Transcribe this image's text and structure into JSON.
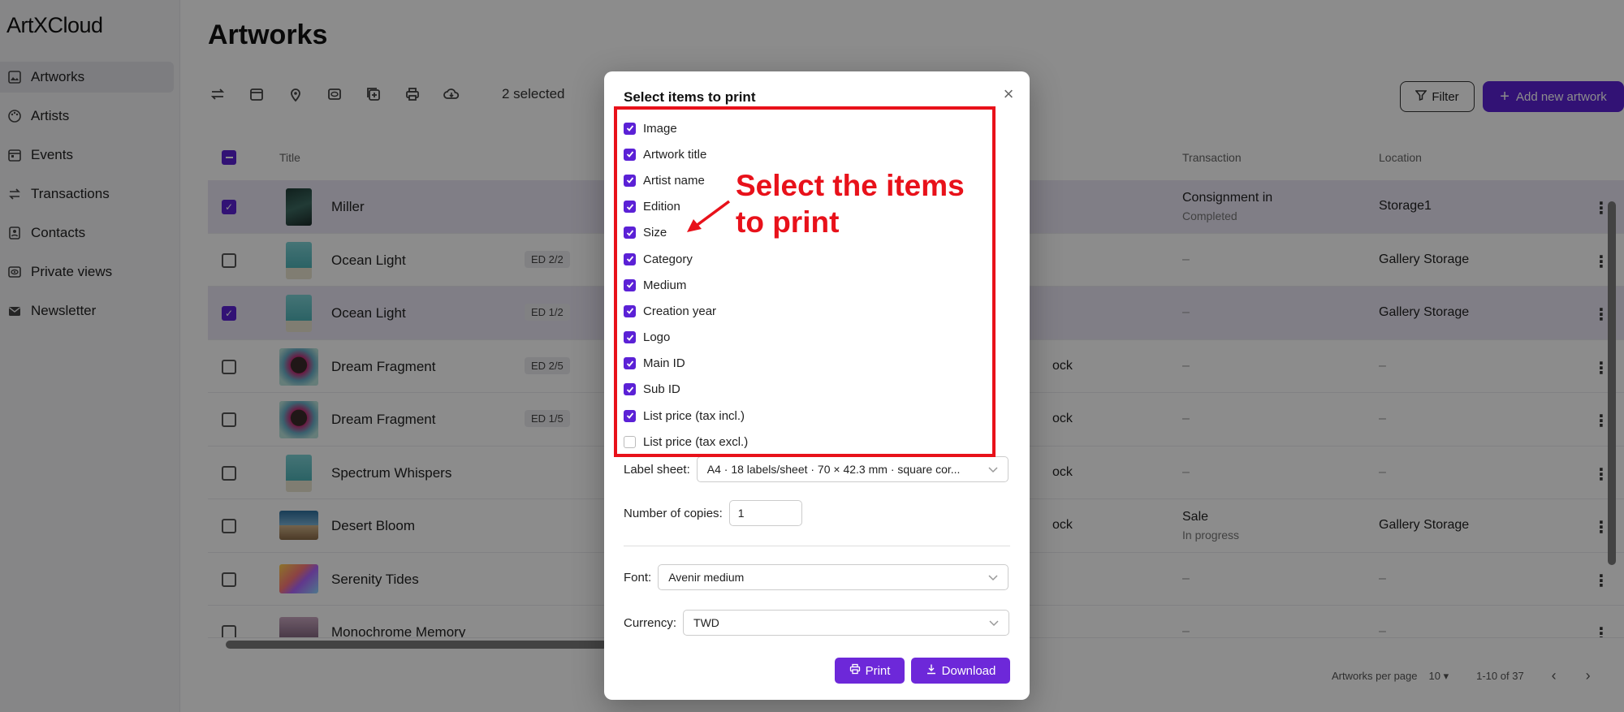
{
  "app": {
    "logo": "ArtXCloud"
  },
  "sidebar": {
    "items": [
      {
        "label": "Artworks",
        "icon": "image-icon",
        "active": true
      },
      {
        "label": "Artists",
        "icon": "palette-icon"
      },
      {
        "label": "Events",
        "icon": "calendar-icon"
      },
      {
        "label": "Transactions",
        "icon": "transfer-icon"
      },
      {
        "label": "Contacts",
        "icon": "contact-icon"
      },
      {
        "label": "Private views",
        "icon": "eye-icon"
      },
      {
        "label": "Newsletter",
        "icon": "mail-icon"
      }
    ]
  },
  "page": {
    "title": "Artworks"
  },
  "toolbar": {
    "selected": "2 selected",
    "filter_label": "Filter",
    "add_label": "Add new artwork"
  },
  "table": {
    "headers": {
      "title": "Title",
      "transaction": "Transaction",
      "location": "Location"
    },
    "rows": [
      {
        "title": "Miller",
        "edition": "",
        "stock": "",
        "transaction": "Consignment in",
        "transaction_status": "Completed",
        "location": "Storage1"
      },
      {
        "title": "Ocean Light",
        "edition": "ED 2/2",
        "stock": "",
        "transaction": "–",
        "transaction_status": "",
        "location": "Gallery Storage"
      },
      {
        "title": "Ocean Light",
        "edition": "ED 1/2",
        "stock": "",
        "transaction": "–",
        "transaction_status": "",
        "location": "Gallery Storage"
      },
      {
        "title": "Dream Fragment",
        "edition": "ED 2/5",
        "stock": "ock",
        "transaction": "–",
        "transaction_status": "",
        "location": "–"
      },
      {
        "title": "Dream Fragment",
        "edition": "ED 1/5",
        "stock": "ock",
        "transaction": "–",
        "transaction_status": "",
        "location": "–"
      },
      {
        "title": "Spectrum Whispers",
        "edition": "",
        "stock": "ock",
        "transaction": "–",
        "transaction_status": "",
        "location": "–"
      },
      {
        "title": "Desert Bloom",
        "edition": "",
        "stock": "ock",
        "transaction": "Sale",
        "transaction_status": "In progress",
        "location": "Gallery Storage"
      },
      {
        "title": "Serenity Tides",
        "edition": "",
        "stock": "",
        "transaction": "–",
        "transaction_status": "",
        "location": "–"
      },
      {
        "title": "Monochrome Memory",
        "edition": "",
        "stock": "",
        "transaction": "–",
        "transaction_status": "",
        "location": "–"
      }
    ]
  },
  "footer": {
    "per_page_label": "Artworks per page",
    "per_page_value": "10",
    "range": "1-10 of 37"
  },
  "modal": {
    "title": "Select items to print",
    "items": [
      {
        "label": "Image",
        "checked": true
      },
      {
        "label": "Artwork title",
        "checked": true
      },
      {
        "label": "Artist name",
        "checked": true
      },
      {
        "label": "Edition",
        "checked": true
      },
      {
        "label": "Size",
        "checked": true
      },
      {
        "label": "Category",
        "checked": true
      },
      {
        "label": "Medium",
        "checked": true
      },
      {
        "label": "Creation year",
        "checked": true
      },
      {
        "label": "Logo",
        "checked": true
      },
      {
        "label": "Main ID",
        "checked": true
      },
      {
        "label": "Sub ID",
        "checked": true
      },
      {
        "label": "List price (tax incl.)",
        "checked": true
      },
      {
        "label": "List price (tax excl.)",
        "checked": false
      }
    ],
    "label_sheet_label": "Label sheet",
    "label_sheet_value": "A4 · 18 labels/sheet · 70 × 42.3 mm · square cor...",
    "copies_label": "Number of copies",
    "copies_value": "1",
    "font_label": "Font",
    "font_value": "Avenir medium",
    "currency_label": "Currency",
    "currency_value": "TWD",
    "print_label": "Print",
    "download_label": "Download"
  },
  "annotation": {
    "line1": "Select the items",
    "line2": "to print"
  },
  "colors": {
    "accent": "#5b21d6",
    "annotation": "#e8111a"
  }
}
